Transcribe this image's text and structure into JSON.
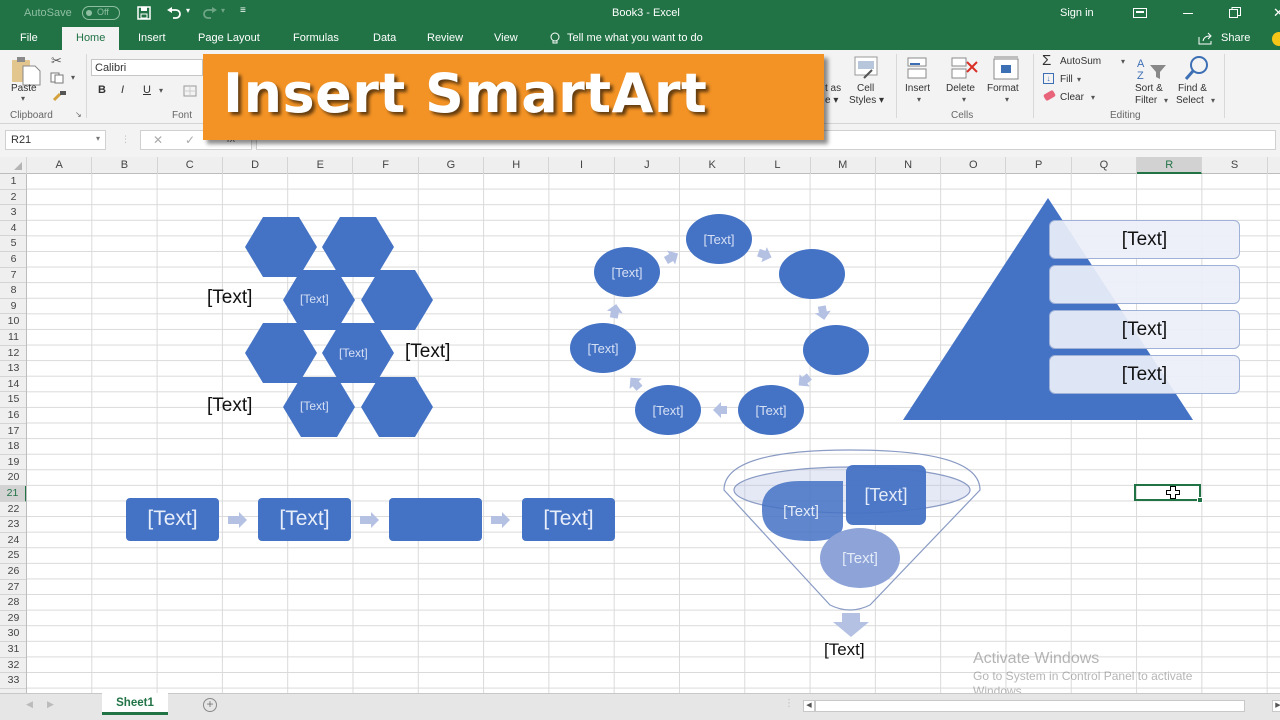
{
  "titlebar": {
    "autosave_label": "AutoSave",
    "autosave_state": "Off",
    "document_title": "Book3  -  Excel",
    "sign_in": "Sign in"
  },
  "ribbon_tabs": [
    {
      "label": "File"
    },
    {
      "label": "Home",
      "active": true
    },
    {
      "label": "Insert"
    },
    {
      "label": "Page Layout"
    },
    {
      "label": "Formulas"
    },
    {
      "label": "Data"
    },
    {
      "label": "Review"
    },
    {
      "label": "View"
    }
  ],
  "tell_me": "Tell me what you want to do",
  "share_label": "Share",
  "ribbon": {
    "clipboard": {
      "paste": "Paste",
      "group_label": "Clipboard"
    },
    "font": {
      "font_name": "Calibri",
      "bold": "B",
      "italic": "I",
      "underline": "U",
      "group_label": "Font"
    },
    "styles": {
      "format_as": "t as",
      "format_as2": "e ▾",
      "cell_styles": "Cell",
      "cell_styles2": "Styles ▾"
    },
    "cells": {
      "insert": "Insert",
      "delete": "Delete",
      "format": "Format",
      "group_label": "Cells"
    },
    "editing": {
      "autosum": "AutoSum",
      "fill": "Fill",
      "clear": "Clear",
      "sort1": "Sort &",
      "sort2": "Filter",
      "find1": "Find &",
      "find2": "Select",
      "group_label": "Editing"
    }
  },
  "formula_bar": {
    "name_box": "R21",
    "formula_value": ""
  },
  "banner": {
    "text": "Insert SmartArt",
    "color": "#f39325"
  },
  "columns": [
    "A",
    "B",
    "C",
    "D",
    "E",
    "F",
    "G",
    "H",
    "I",
    "J",
    "K",
    "L",
    "M",
    "N",
    "O",
    "P",
    "Q",
    "R",
    "S"
  ],
  "rows": [
    "1",
    "2",
    "3",
    "4",
    "5",
    "6",
    "7",
    "8",
    "9",
    "10",
    "11",
    "12",
    "13",
    "14",
    "15",
    "16",
    "17",
    "18",
    "19",
    "20",
    "21",
    "22",
    "23",
    "24",
    "25",
    "26",
    "27",
    "28",
    "29",
    "30",
    "31",
    "32",
    "33"
  ],
  "selected_cell": {
    "column": "R",
    "row": "21"
  },
  "smartart": {
    "accent_color": "#4472c4",
    "light_color": "#b4c1e3",
    "hexagon_cluster": {
      "inner_labels": [
        "[Text]",
        "[Text]",
        "[Text]"
      ],
      "side_labels": [
        "[Text]",
        "[Text]",
        "[Text]"
      ]
    },
    "cycle": {
      "nodes": [
        "[Text]",
        "",
        "",
        "[Text]",
        "[Text]",
        "[Text]",
        "[Text]"
      ]
    },
    "pyramid": {
      "items": [
        "[Text]",
        "",
        "[Text]",
        "[Text]"
      ]
    },
    "process": {
      "steps": [
        "[Text]",
        "[Text]",
        "",
        "[Text]"
      ]
    },
    "funnel": {
      "items": [
        "[Text]",
        "[Text]",
        "[Text]"
      ],
      "result": "[Text]"
    }
  },
  "sheet_tabs": [
    {
      "label": "Sheet1",
      "active": true
    }
  ],
  "watermark": {
    "title": "Activate Windows",
    "subtitle": "Go to System in Control Panel to activate",
    "subtitle2": "Windows."
  }
}
